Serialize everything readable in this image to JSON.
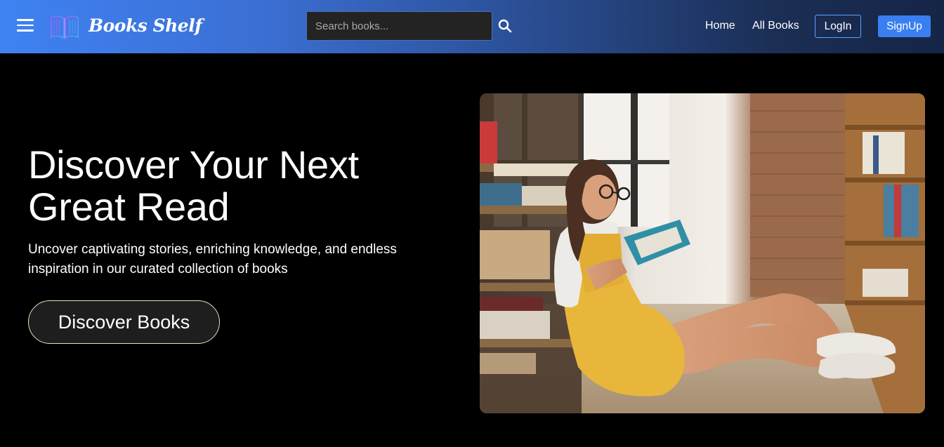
{
  "navbar": {
    "menu_icon": "hamburger-menu-icon",
    "logo_icon": "open-book-icon",
    "brand": "Books Shelf",
    "search": {
      "placeholder": "Search books...",
      "value": "",
      "icon": "search-icon"
    },
    "links": {
      "home": "Home",
      "all_books": "All Books"
    },
    "login_label": "LogIn",
    "signup_label": "SignUp"
  },
  "hero": {
    "title": "Discover Your Next Great Read",
    "subtitle": "Uncover captivating stories, enriching knowledge, and endless inspiration in our curated collection of books",
    "cta_label": "Discover Books",
    "image": "girl-reading-book-in-library-photo"
  },
  "colors": {
    "nav_gradient_start": "#3f82f2",
    "nav_gradient_end": "#162546",
    "signup_bg": "#3a7ff1",
    "login_border": "#58a4ff",
    "page_bg": "#000000",
    "cta_border": "#e7dfb8"
  }
}
